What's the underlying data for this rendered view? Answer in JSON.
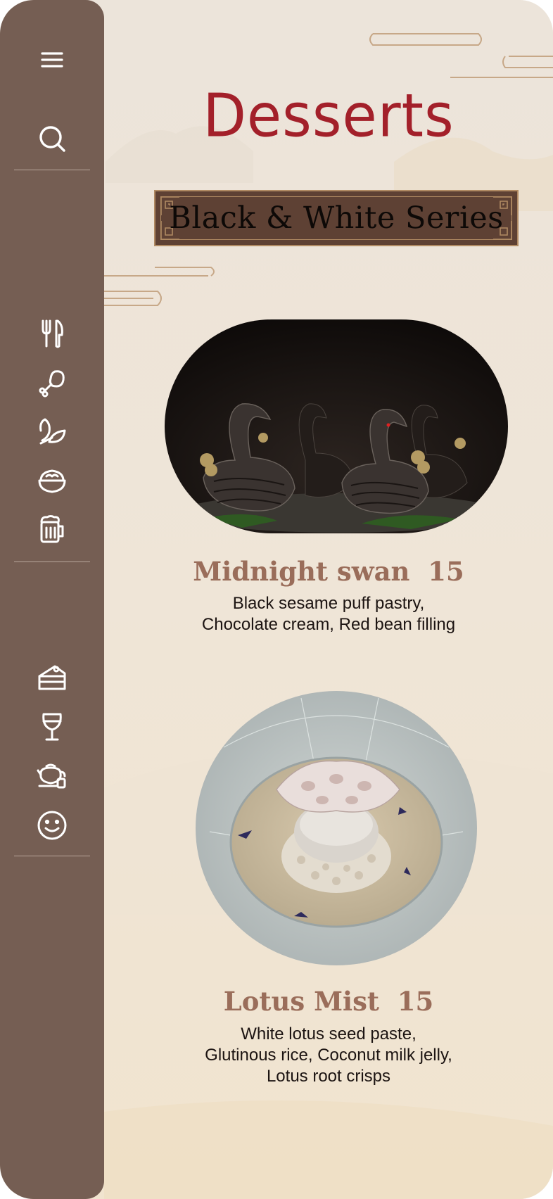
{
  "sidebar": {
    "icons": [
      {
        "name": "menu-icon"
      },
      {
        "name": "search-icon"
      },
      {
        "name": "fork-knife-icon"
      },
      {
        "name": "chicken-leg-icon"
      },
      {
        "name": "leaf-icon"
      },
      {
        "name": "rice-bowl-icon"
      },
      {
        "name": "beer-mug-icon"
      },
      {
        "name": "cake-icon"
      },
      {
        "name": "wine-glass-icon"
      },
      {
        "name": "teapot-icon"
      },
      {
        "name": "smiley-icon"
      }
    ],
    "background": "#755e53"
  },
  "page": {
    "title": "Desserts",
    "subtitle": "Black & White Series"
  },
  "dishes": [
    {
      "name": "Midnight swan",
      "price": "15",
      "description": [
        "Black sesame puff pastry,",
        "Chocolate cream, Red bean filling"
      ]
    },
    {
      "name": "Lotus Mist",
      "price": "15",
      "description": [
        "White lotus seed paste,",
        "Glutinous rice, Coconut milk jelly,",
        "Lotus root crisps"
      ]
    }
  ],
  "colors": {
    "title": "#a3202a",
    "dish_name": "#9a6d5a",
    "banner": "#5e4134",
    "paper": "#efe6da"
  }
}
